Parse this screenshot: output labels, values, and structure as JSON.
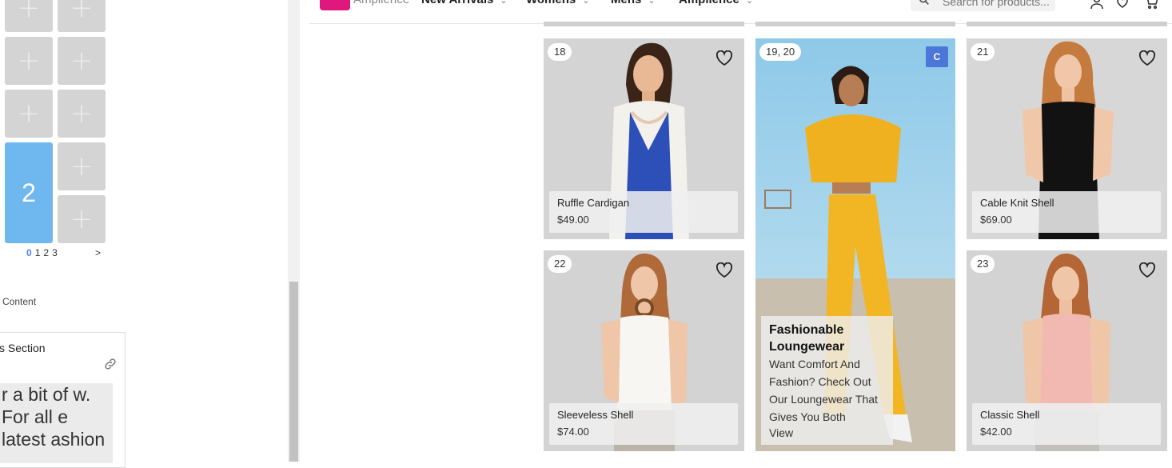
{
  "editor": {
    "active_slot_number": "2",
    "pager": {
      "pages": [
        "0",
        "1",
        "2",
        "3"
      ],
      "current": "0",
      "next": ">"
    },
    "content_label": "Content",
    "section_title": "s Section",
    "section_preview_text": "r a bit of w. For all e latest ashion"
  },
  "store": {
    "brand_name": "Amplience",
    "nav": [
      "New Arrivals",
      "Womens",
      "Mens",
      "Amplience"
    ],
    "search_placeholder": "Search for products...",
    "icons": {
      "account": "user-icon",
      "wishlist": "heart-icon",
      "cart": "cart-icon"
    }
  },
  "products": [
    {
      "slot": "18",
      "name": "Ruffle Cardigan",
      "price": "$49.00"
    },
    {
      "slot": "21",
      "name": "Cable Knit Shell",
      "price": "$69.00"
    },
    {
      "slot": "22",
      "name": "Sleeveless Shell",
      "price": "$74.00"
    },
    {
      "slot": "23",
      "name": "Classic Shell",
      "price": "$42.00"
    }
  ],
  "promo": {
    "slot": "19, 20",
    "content_badge": "C",
    "title": "Fashionable Loungewear",
    "text": "Want Comfort And Fashion? Check Out Our Loungewear That Gives You Both",
    "link": "View"
  },
  "colors": {
    "brand": "#e0187e",
    "active_slot": "#6fb7ef",
    "content_badge": "#4d76d9"
  }
}
